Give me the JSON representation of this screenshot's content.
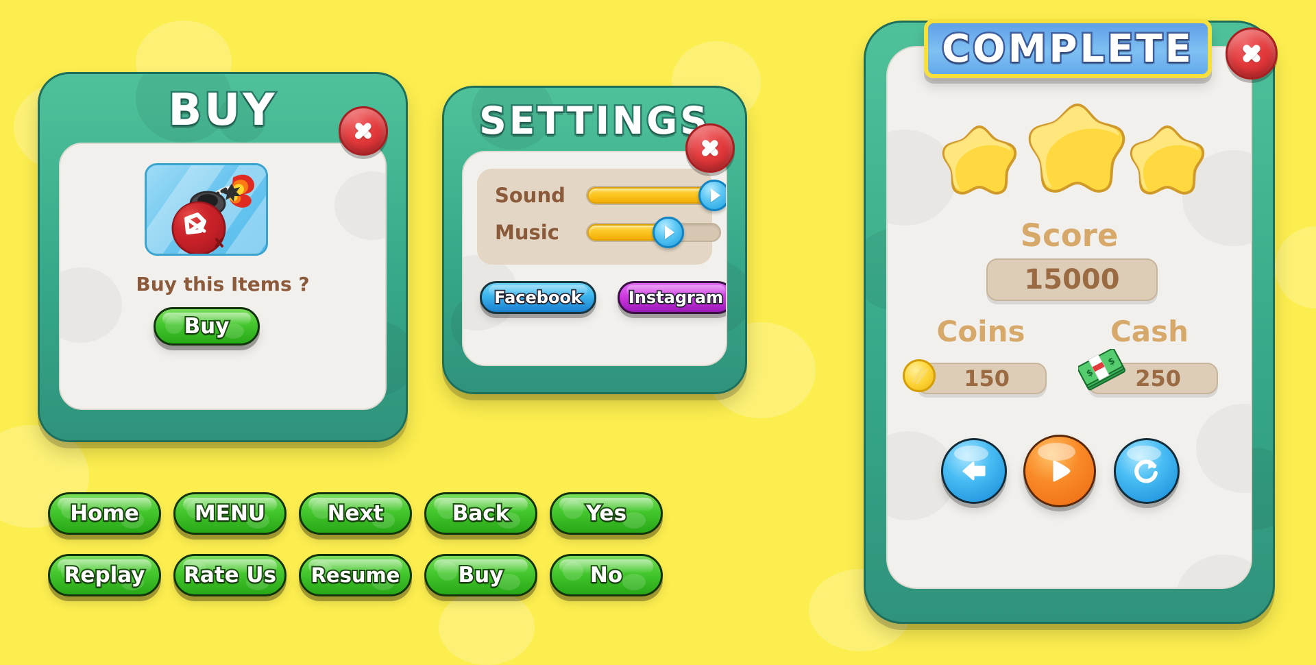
{
  "theme": {
    "background": "#fcee4f",
    "panel_green": "#37a98a",
    "panel_green_dark": "#1e6e5c",
    "panel_cream": "#f2f0ec",
    "accent_brown": "#8a5a3b",
    "gold": "#fbc21c",
    "close_red": "#e33a3c",
    "green_button": "#46c82f",
    "facebook_blue": "#3bb4ec",
    "instagram_purple": "#cf3ae0",
    "banner_blue": "#7fc0f2",
    "banner_border_yellow": "#f7e03b",
    "star_yellow": "#ffd93f",
    "stat_box": "#ddcdb6",
    "stat_label_tan": "#d6a96b"
  },
  "buy_panel": {
    "title": "BUY",
    "close_icon": "close-icon",
    "item_icon": "bomb-item-icon",
    "question": "Buy this Items ?",
    "buy_button": "Buy"
  },
  "settings_panel": {
    "title": "SETTINGS",
    "close_icon": "close-icon",
    "sliders": [
      {
        "label": "Sound",
        "value": 96
      },
      {
        "label": "Music",
        "value": 61
      }
    ],
    "social_buttons": [
      {
        "label": "Facebook",
        "name": "facebook-button"
      },
      {
        "label": "Instagram",
        "name": "instagram-button"
      }
    ]
  },
  "complete_panel": {
    "banner_title": "COMPLETE",
    "close_icon": "close-icon",
    "stars_earned": 3,
    "score_label": "Score",
    "score_value": "15000",
    "coins_label": "Coins",
    "coins_value": "150",
    "cash_label": "Cash",
    "cash_value": "250",
    "actions": [
      {
        "name": "back-button",
        "icon": "left-arrow-icon",
        "color": "blue"
      },
      {
        "name": "play-button",
        "icon": "play-icon",
        "color": "orange"
      },
      {
        "name": "replay-button",
        "icon": "refresh-icon",
        "color": "blue"
      }
    ]
  },
  "button_grid": {
    "row1": [
      "Home",
      "MENU",
      "Next",
      "Back",
      "Yes"
    ],
    "row2": [
      "Replay",
      "Rate Us",
      "Resume",
      "Buy",
      "No"
    ]
  }
}
